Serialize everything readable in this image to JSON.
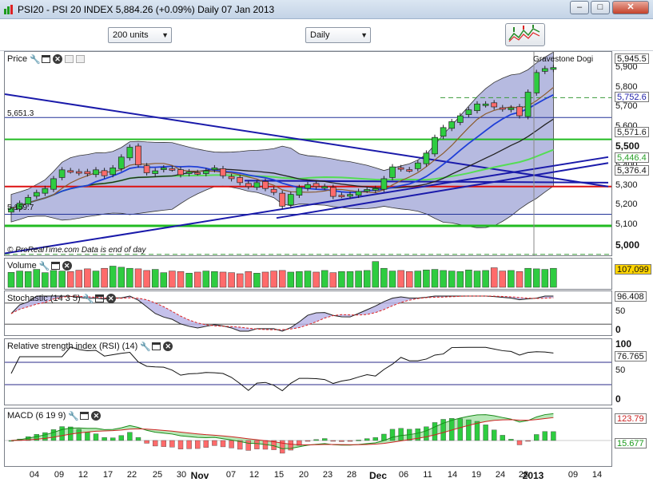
{
  "window": {
    "title": "PSI20 - PSI 20 INDEX      5,884.26 (+0.09%)     Daily  07 Jan 2013",
    "buttons": [
      "–",
      "□",
      "✕"
    ]
  },
  "toolbar": {
    "units_select": "200 units",
    "period_select": "Daily"
  },
  "colors": {
    "up": "#2ecc40",
    "down": "#ff6b6b",
    "band_fill": "#9da3d6",
    "trendline": "#1a1aaa",
    "ma_blue": "#1f3fd8",
    "ma_green": "#55dd55",
    "ma_brown": "#8b5a2b",
    "support_green": "#22bb22",
    "support_red": "#dd1111"
  },
  "price_panel": {
    "label": "Price",
    "annotation": "Gravestone Dogi",
    "watermark": "© ProRealTime.com   Data is end of day",
    "left_labels": [
      "5,651.3",
      "5,159.7"
    ],
    "axis_ticks": [
      "5,900",
      "5,800",
      "5,700",
      "5,600",
      "5,500",
      "5,400",
      "5,300",
      "5,200",
      "5,100",
      "5,000"
    ],
    "axis_major_ticks": [
      "5,500",
      "5,000"
    ],
    "value_labels": [
      "5,945.5",
      "5,752.6",
      "5,571.6",
      "5,446.4",
      "5,376.4"
    ],
    "ylim": [
      4950,
      5985
    ]
  },
  "volume_panel": {
    "label": "Volume",
    "value_label": "107,099"
  },
  "stochastic_panel": {
    "label": "Stochastic (14 3 5)",
    "axis_ticks": [
      "100",
      "50",
      "0"
    ],
    "value_label": "96.408"
  },
  "rsi_panel": {
    "label": "Relative strength index (RSI) (14)",
    "axis_ticks": [
      "100",
      "50",
      "0"
    ],
    "value_label": "76.765"
  },
  "macd_panel": {
    "label": "MACD (6 19 9)",
    "value_labels": [
      "123.79",
      "15.677"
    ]
  },
  "x_axis": {
    "labels": [
      "04",
      "09",
      "12",
      "17",
      "22",
      "25",
      "30",
      "Nov",
      "07",
      "12",
      "15",
      "20",
      "23",
      "28",
      "Dec",
      "06",
      "11",
      "14",
      "19",
      "24",
      "28",
      "2013",
      "09",
      "14"
    ],
    "major": [
      "Nov",
      "Dec",
      "2013"
    ]
  },
  "chart_data": {
    "type": "candlestick",
    "instrument": "PSI20 - PSI 20 INDEX",
    "period": "Daily",
    "close": [
      5190,
      5215,
      5245,
      5270,
      5290,
      5340,
      5385,
      5380,
      5370,
      5365,
      5385,
      5355,
      5395,
      5450,
      5500,
      5410,
      5370,
      5380,
      5395,
      5390,
      5360,
      5375,
      5370,
      5380,
      5395,
      5355,
      5340,
      5320,
      5300,
      5320,
      5290,
      5270,
      5200,
      5260,
      5295,
      5310,
      5300,
      5300,
      5250,
      5255,
      5260,
      5275,
      5285,
      5290,
      5340,
      5400,
      5390,
      5385,
      5420,
      5470,
      5550,
      5600,
      5630,
      5660,
      5690,
      5720,
      5720,
      5705,
      5695,
      5700,
      5660,
      5780,
      5880,
      5900,
      5905
    ],
    "volume": [
      55,
      60,
      58,
      66,
      54,
      62,
      60,
      58,
      63,
      68,
      60,
      70,
      78,
      74,
      70,
      68,
      62,
      66,
      54,
      60,
      58,
      52,
      56,
      60,
      58,
      56,
      54,
      50,
      58,
      52,
      56,
      60,
      62,
      56,
      58,
      60,
      56,
      62,
      54,
      58,
      58,
      60,
      62,
      95,
      70,
      60,
      62,
      58,
      60,
      64,
      66,
      62,
      60,
      58,
      64,
      60,
      62,
      72,
      60,
      62,
      58,
      70,
      68,
      66,
      70
    ]
  }
}
